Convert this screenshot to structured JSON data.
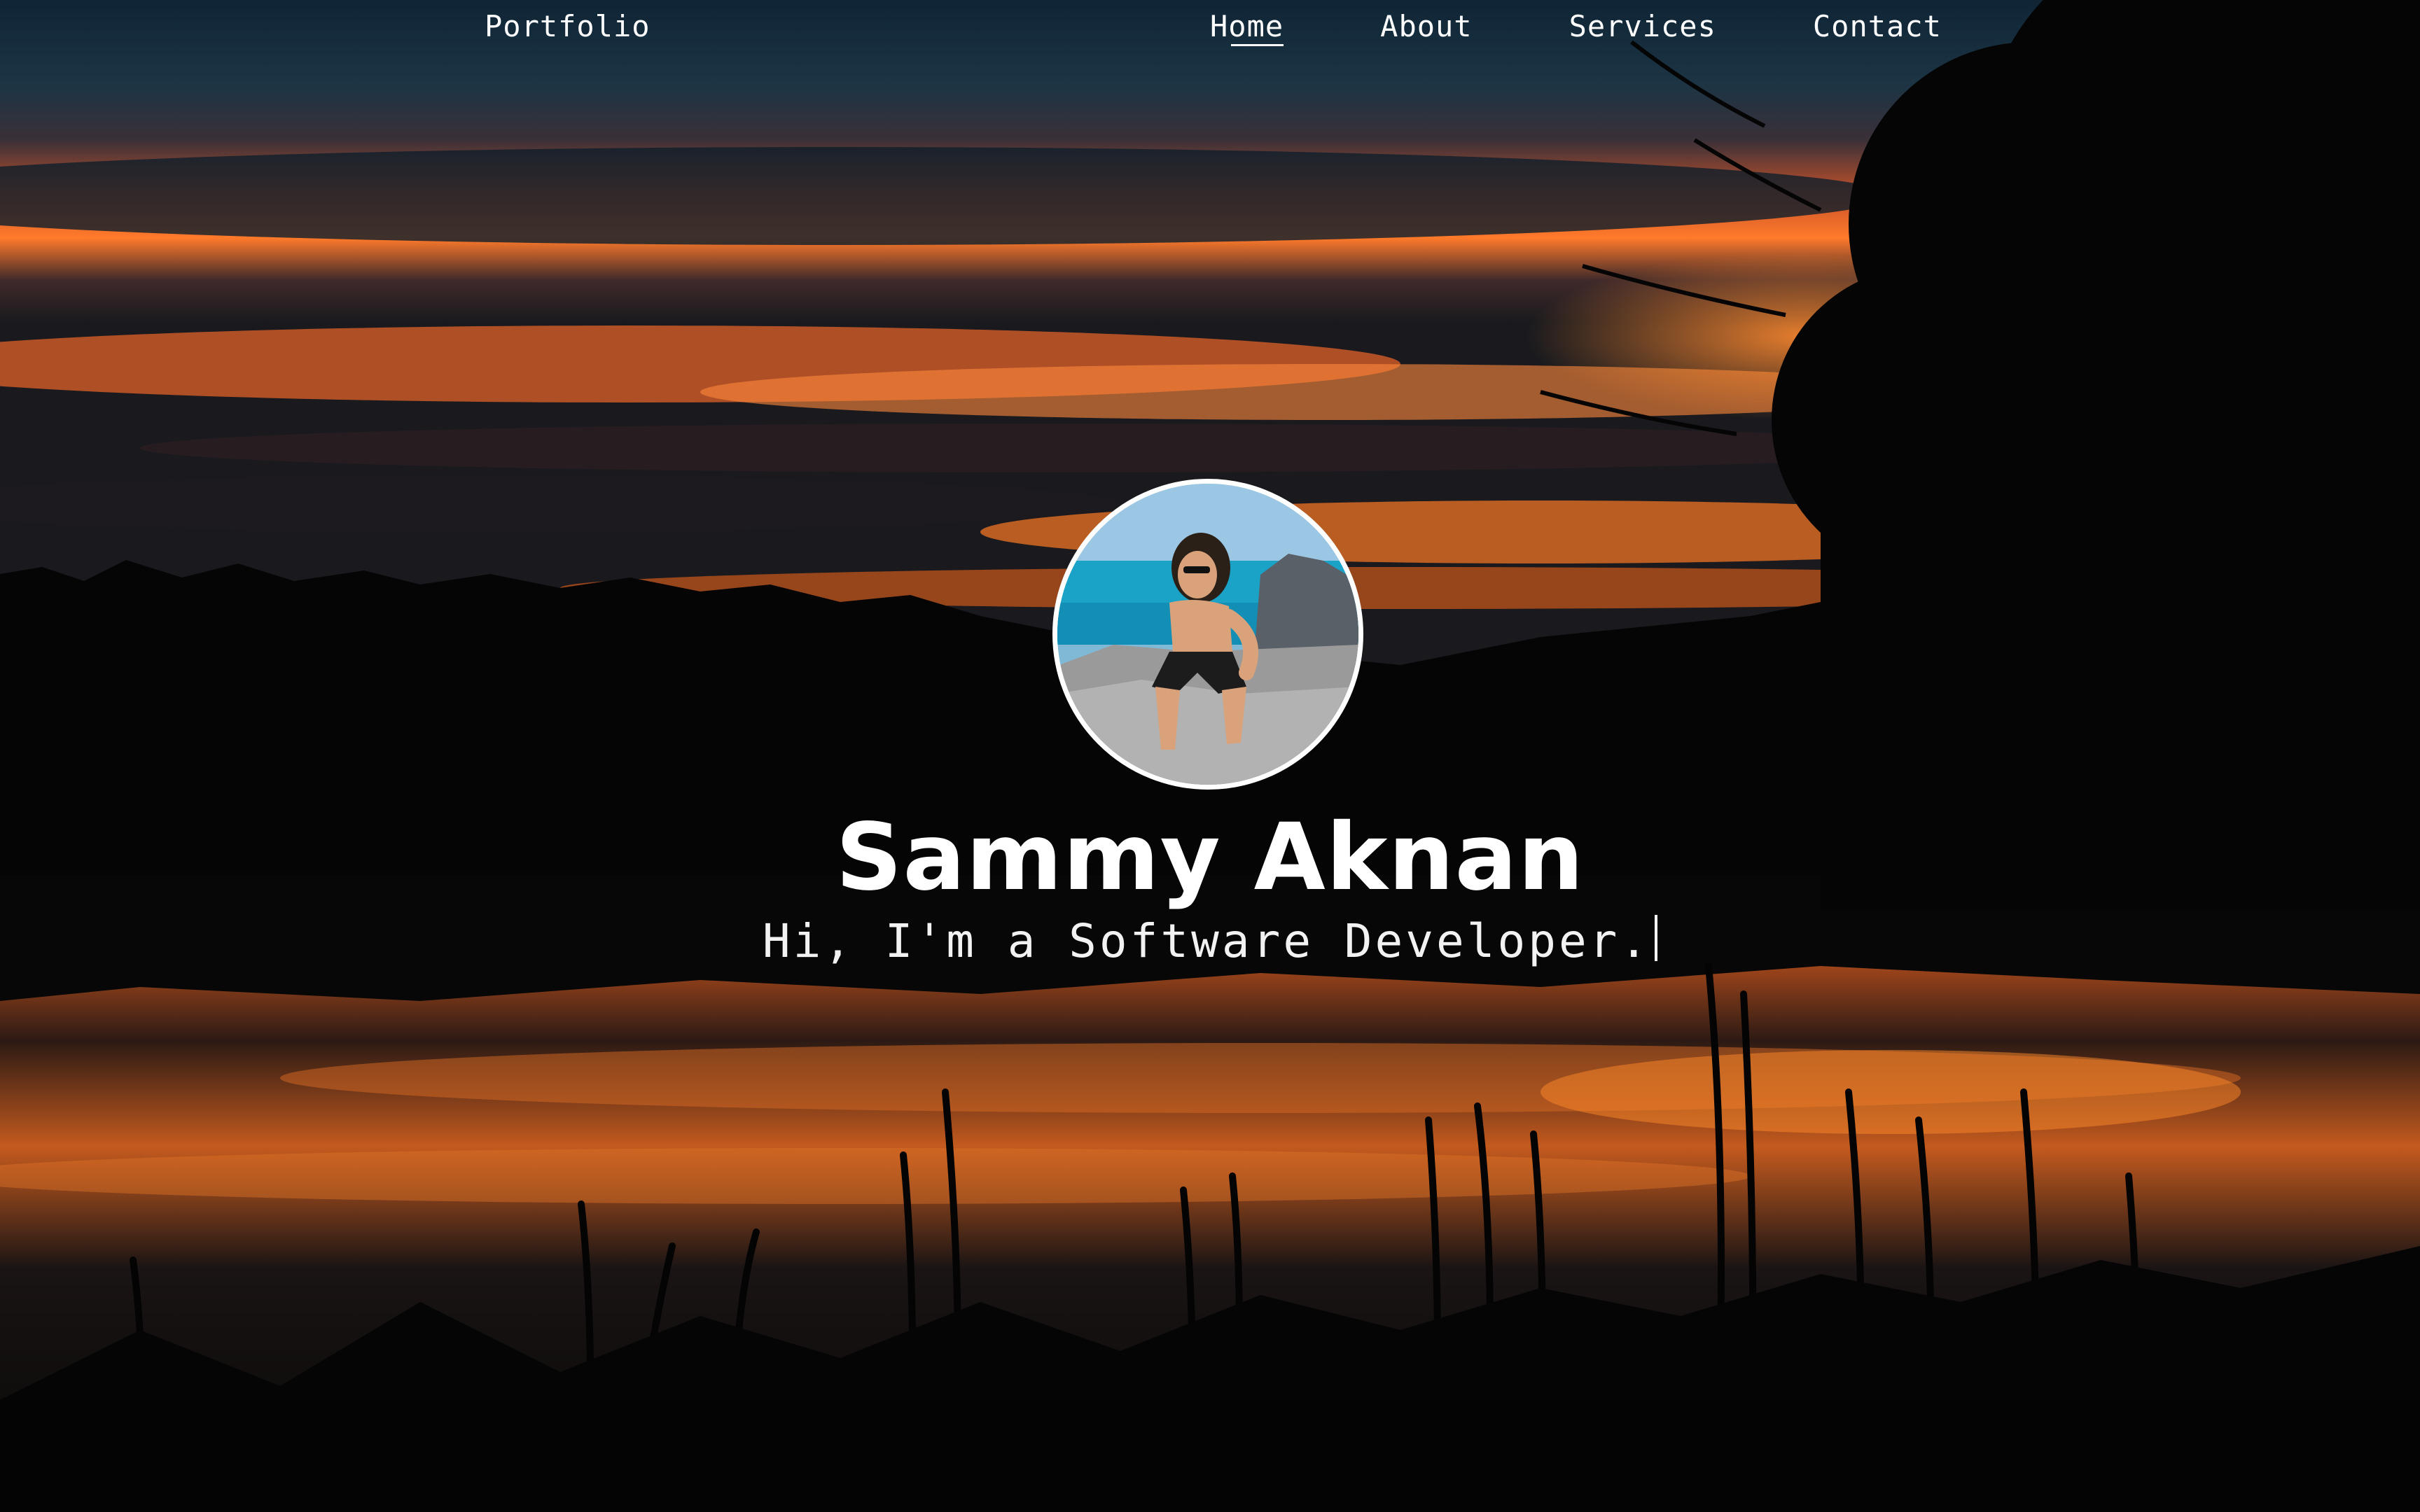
{
  "navbar": {
    "brand": "Portfolio",
    "links": [
      {
        "label": "Home",
        "active": true
      },
      {
        "label": "About",
        "active": false
      },
      {
        "label": "Services",
        "active": false
      },
      {
        "label": "Contact",
        "active": false
      }
    ]
  },
  "hero": {
    "name": "Sammy Aknan",
    "tagline": "Hi, I'm a Software Developer."
  },
  "colors": {
    "text": "#ffffff",
    "sky_dark": "#0f2535",
    "sunset_orange": "#ff6a1a",
    "silhouette": "#050505"
  }
}
